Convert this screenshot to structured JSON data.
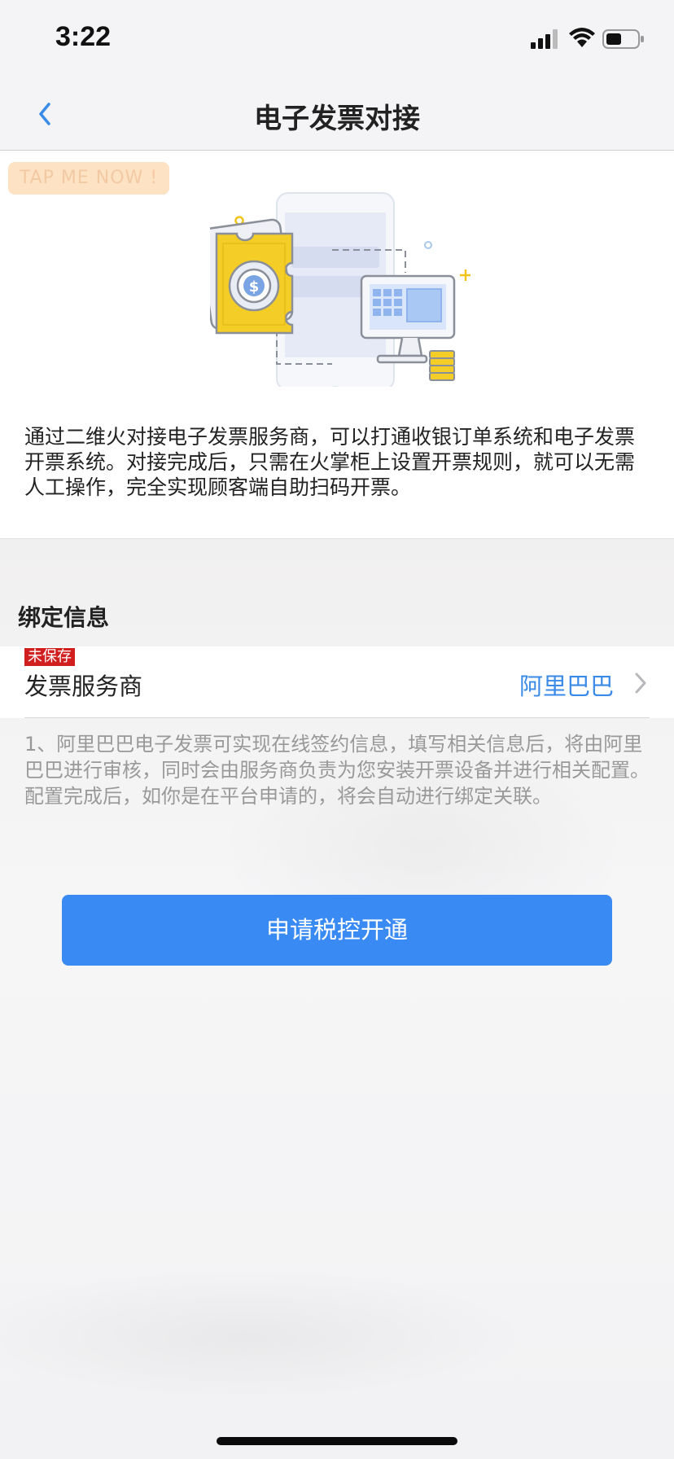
{
  "status_bar": {
    "time": "3:22"
  },
  "nav": {
    "title": "电子发票对接",
    "back_icon": "chevron-left-icon"
  },
  "intro": {
    "tap_badge": "TAP ME NOW !",
    "illustration": "invoice-terminal-illustration",
    "description": "通过二维火对接电子发票服务商，可以打通收银订单系统和电子发票开票系统。对接完成后，只需在火掌柜上设置开票规则，就可以无需人工操作，完全实现顾客端自助扫码开票。"
  },
  "binding": {
    "section_title": "绑定信息",
    "provider": {
      "unsaved_badge": "未保存",
      "label": "发票服务商",
      "value": "阿里巴巴"
    },
    "note": "1、阿里巴巴电子发票可实现在线签约信息，填写相关信息后，将由阿里巴巴进行审核，同时会由服务商负责为您安装开票设备并进行相关配置。配置完成后，如你是在平台申请的，将会自动进行绑定关联。"
  },
  "actions": {
    "apply_label": "申请税控开通"
  },
  "colors": {
    "accent": "#3a8af3",
    "link": "#3a8ae8",
    "badge_red": "#d11f1f",
    "tap_badge_bg": "#fde3c4"
  }
}
